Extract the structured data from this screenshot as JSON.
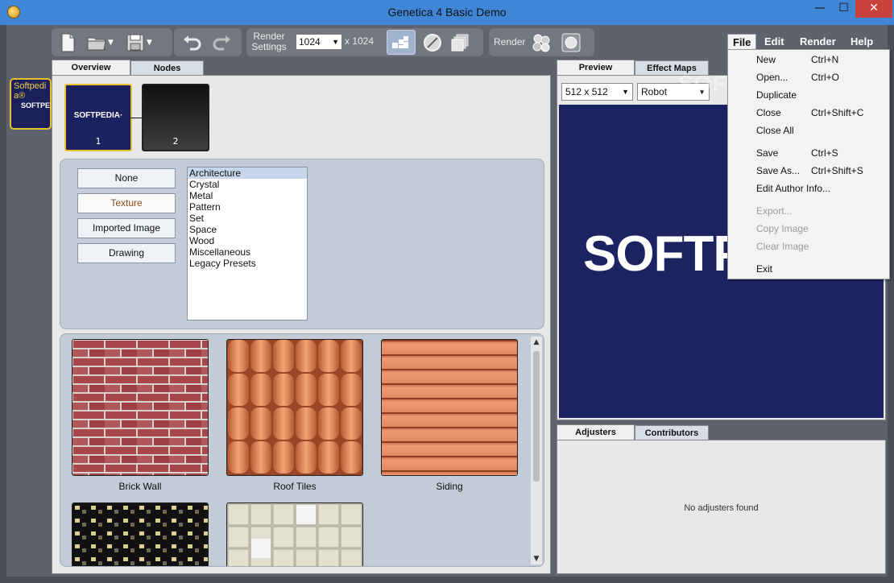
{
  "window": {
    "title": "Genetica 4 Basic Demo",
    "min": "—",
    "max": "☐",
    "close": "✕"
  },
  "toolbar": {
    "render_settings_line1": "Render",
    "render_settings_line2": "Settings",
    "size_value": "1024",
    "size_x": "x 1024",
    "render_label": "Render"
  },
  "left_node": {
    "line1": "Softpedi",
    "line2": "a®",
    "logo": "SOFTPEDIA"
  },
  "overview": {
    "tabs": [
      "Overview",
      "Nodes"
    ],
    "nodes": [
      {
        "num": "1",
        "logo": "SOFTPEDIA·"
      },
      {
        "num": "2"
      }
    ],
    "type_buttons": [
      "None",
      "Texture",
      "Imported Image",
      "Drawing"
    ],
    "selected_type": "Texture",
    "categories": [
      "Architecture",
      "Crystal",
      "Metal",
      "Pattern",
      "Set",
      "Space",
      "Wood",
      "Miscellaneous",
      "Legacy Presets"
    ],
    "selected_category": "Architecture",
    "textures": [
      "Brick Wall",
      "Roof Tiles",
      "Siding"
    ]
  },
  "preview": {
    "tabs": [
      "Preview",
      "Effect Maps"
    ],
    "resolution": "512 x 512",
    "model": "Robot",
    "logo": "SOFTPEDIA"
  },
  "adjusters": {
    "tabs": [
      "Adjusters",
      "Contributors"
    ],
    "empty_text": "No adjusters found"
  },
  "menubar": [
    "File",
    "Edit",
    "Render",
    "Help"
  ],
  "file_menu": [
    {
      "label": "New",
      "shortcut": "Ctrl+N",
      "enabled": true
    },
    {
      "label": "Open...",
      "shortcut": "Ctrl+O",
      "enabled": true
    },
    {
      "label": "Duplicate",
      "shortcut": "",
      "enabled": true
    },
    {
      "label": "Close",
      "shortcut": "Ctrl+Shift+C",
      "enabled": true
    },
    {
      "label": "Close All",
      "shortcut": "",
      "enabled": true
    },
    {
      "label": "Save",
      "shortcut": "Ctrl+S",
      "enabled": true
    },
    {
      "label": "Save As...",
      "shortcut": "Ctrl+Shift+S",
      "enabled": true
    },
    {
      "label": "Edit Author Info...",
      "shortcut": "",
      "enabled": true
    },
    {
      "label": "Export...",
      "shortcut": "",
      "enabled": false
    },
    {
      "label": "Copy Image",
      "shortcut": "",
      "enabled": false
    },
    {
      "label": "Clear Image",
      "shortcut": "",
      "enabled": false
    },
    {
      "label": "Exit",
      "shortcut": "",
      "enabled": true
    }
  ],
  "watermark": "SOFTPEDIA"
}
